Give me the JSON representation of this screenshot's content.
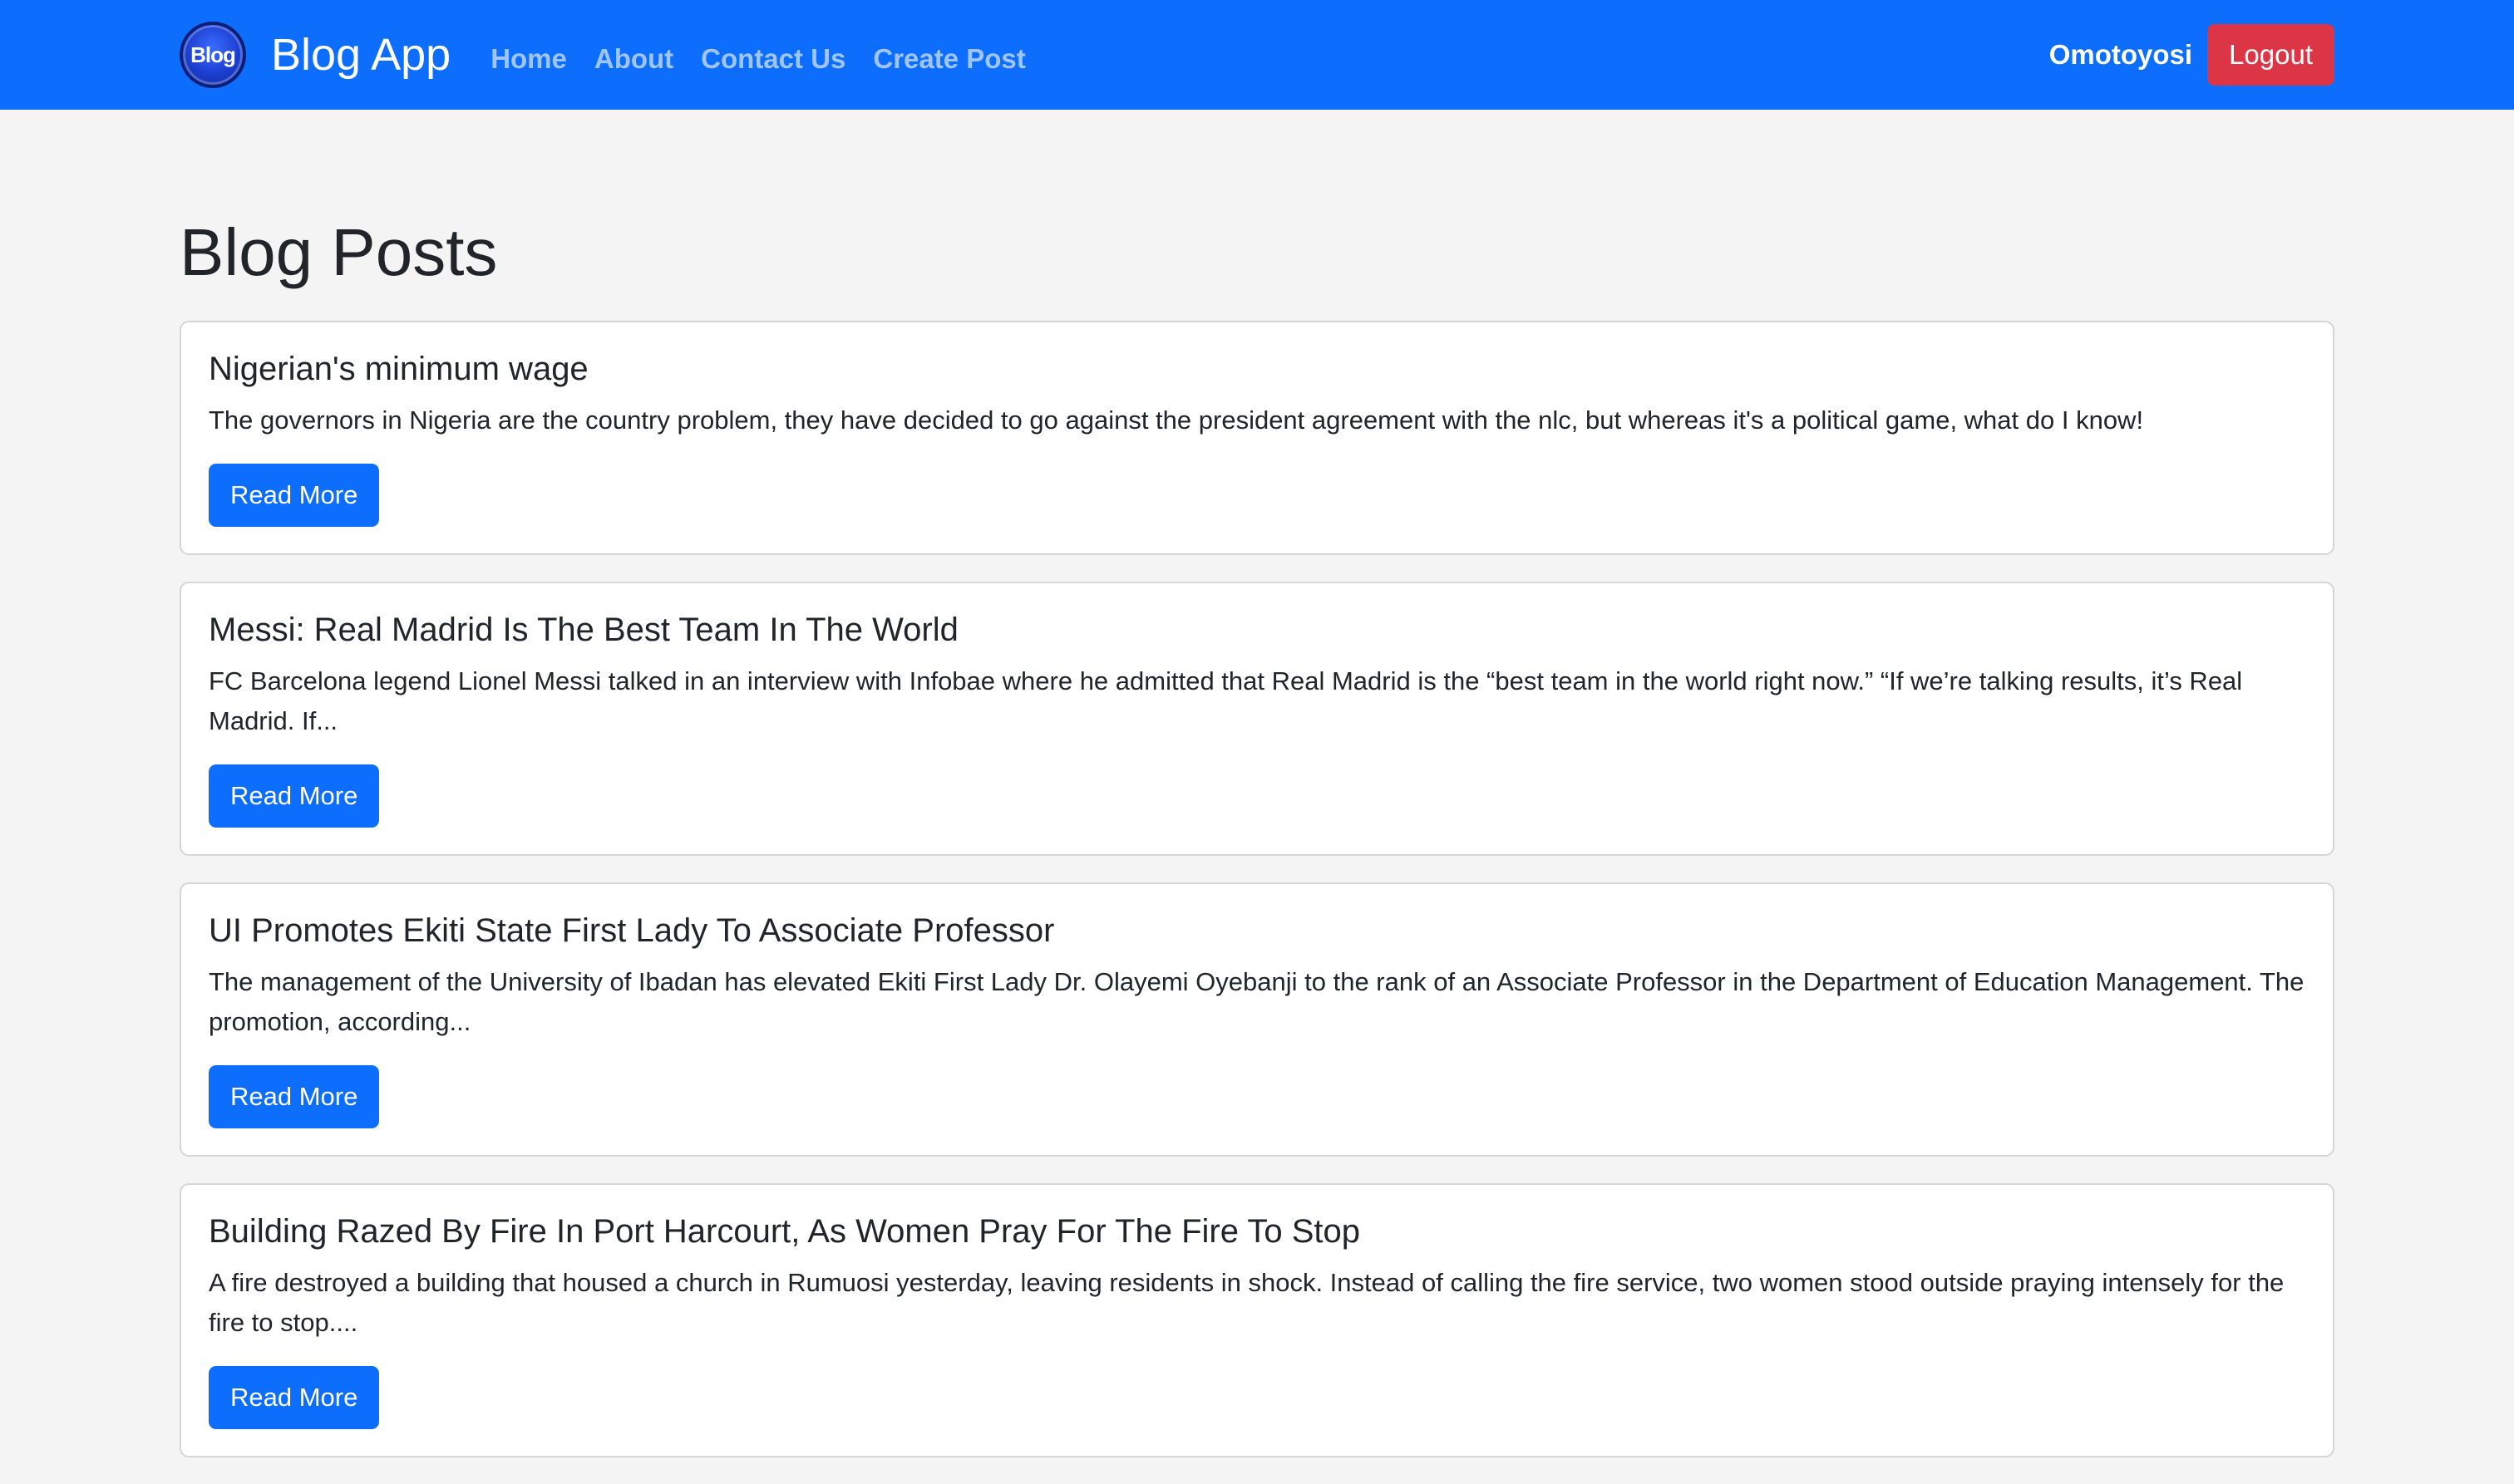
{
  "navbar": {
    "logo_text": "Blog",
    "brand": "Blog App",
    "links": [
      {
        "label": "Home"
      },
      {
        "label": "About"
      },
      {
        "label": "Contact Us"
      },
      {
        "label": "Create Post"
      }
    ],
    "username": "Omotoyosi",
    "logout_label": "Logout",
    "colors": {
      "background": "#0d6efd",
      "logout": "#dc3545"
    }
  },
  "main": {
    "title": "Blog Posts",
    "posts": [
      {
        "title": "Nigerian's minimum wage",
        "excerpt": "The governors in Nigeria are the country problem, they have decided to go against the president agreement with the nlc, but whereas it's a political game, what do I know!",
        "button": "Read More"
      },
      {
        "title": "Messi: Real Madrid Is The Best Team In The World",
        "excerpt": "FC Barcelona legend Lionel Messi talked in an interview with Infobae where he admitted that Real Madrid is the “best team in the world right now.” “If we’re talking results, it’s Real Madrid. If...",
        "button": "Read More"
      },
      {
        "title": "UI Promotes Ekiti State First Lady To Associate Professor",
        "excerpt": "The management of the University of Ibadan has elevated Ekiti First Lady Dr. Olayemi Oyebanji to the rank of an Associate Professor in the Department of Education Management. The promotion, according...",
        "button": "Read More"
      },
      {
        "title": "Building Razed By Fire In Port Harcourt, As Women Pray For The Fire To Stop",
        "excerpt": "A fire destroyed a building that housed a church in Rumuosi yesterday, leaving residents in shock. Instead of calling the fire service, two women stood outside praying intensely for the fire to stop....",
        "button": "Read More"
      }
    ]
  }
}
